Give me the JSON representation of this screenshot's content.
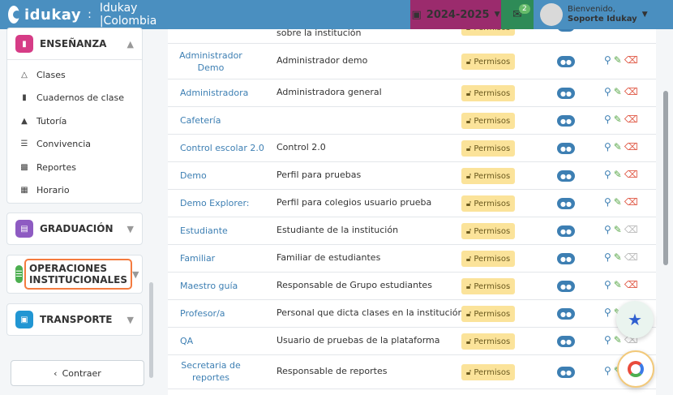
{
  "topbar": {
    "logo": "idukay",
    "separator": ":",
    "school": "Idukay |Colombia",
    "year": "2024-2025",
    "mail_count": "2",
    "welcome": "Bienvenido,",
    "user": "Soporte Idukay"
  },
  "sidebar": {
    "ensenanza": {
      "label": "ENSEÑANZA",
      "items": [
        "Clases",
        "Cuadernos de clase",
        "Tutoría",
        "Convivencia",
        "Reportes",
        "Horario"
      ]
    },
    "graduacion": "GRADUACIÓN",
    "operaciones": "OPERACIONES INSTITUCIONALES",
    "transporte": "TRANSPORTE",
    "collapse": "Contraer"
  },
  "table": {
    "top_partial": "sobre la institución",
    "permisos_label": "Permisos",
    "rows": [
      {
        "name": "Administrador Demo",
        "desc": "Administrador demo"
      },
      {
        "name": "Administradora",
        "desc": "Administradora general"
      },
      {
        "name": "Cafetería",
        "desc": ""
      },
      {
        "name": "Control escolar 2.0",
        "desc": "Control 2.0"
      },
      {
        "name": "Demo",
        "desc": "Perfil para pruebas"
      },
      {
        "name": "Demo Explorer:",
        "desc": "Perfil para colegios usuario prueba"
      },
      {
        "name": "Estudiante",
        "desc": "Estudiante de la institución"
      },
      {
        "name": "Familiar",
        "desc": "Familiar de estudiantes"
      },
      {
        "name": "Maestro guía",
        "desc": "Responsable de Grupo estudiantes"
      },
      {
        "name": "Profesor/a",
        "desc": "Personal que dicta clases en la institución"
      },
      {
        "name": "QA",
        "desc": "Usuario de pruebas de la plataforma"
      },
      {
        "name": "Secretaria de reportes",
        "desc": "Responsable de reportes"
      }
    ]
  },
  "colors": {
    "topbar": "#4a8fc0",
    "year": "#9b2b6d",
    "mail": "#2e8b57",
    "link": "#3d7fb3",
    "permisos": "#fbe39a",
    "highlight": "#f47b3f"
  },
  "icons": [
    "menu-icon",
    "calendar-icon",
    "envelope-icon",
    "chevron-down-icon",
    "flask-icon",
    "book-icon",
    "thumbs-up-icon",
    "list-icon",
    "bar-chart-icon",
    "calendar-grid-icon",
    "lock-icon",
    "users-icon",
    "search-plus-icon",
    "pencil-icon",
    "trash-icon",
    "star-icon"
  ]
}
